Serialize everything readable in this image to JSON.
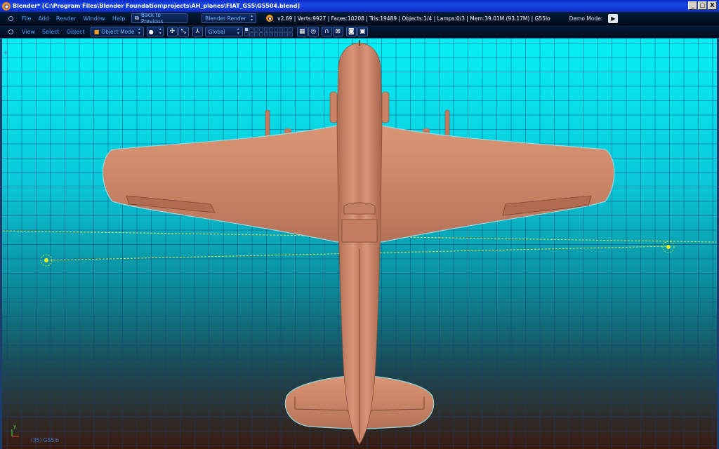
{
  "window": {
    "title": "Blender* [C:\\Program Files\\Blender Foundation\\projects\\AH_planes\\FIAT_G55\\G5504.blend]",
    "controls": [
      "_",
      "□",
      "X"
    ]
  },
  "info_header": {
    "menu": [
      "File",
      "Add",
      "Render",
      "Window",
      "Help"
    ],
    "back_button": "Back to Previous",
    "render_engine": "Blender Render",
    "stats": "v2.69 | Verts:9927 | Faces:10208 | Tris:19489 | Objects:1/4 | Lamps:0/3 | Mem:39.01M (93.17M) | G55lo",
    "demo_label": "Demo Mode:",
    "play_glyph": "▶"
  },
  "view3d_header": {
    "menu": [
      "View",
      "Select",
      "Object"
    ],
    "mode": "Object Mode",
    "orientation": "Global"
  },
  "viewport": {
    "corner_glyph": "+",
    "object_info": "(35) G55lo",
    "axis_label": "y",
    "colors": {
      "grid": "#143c78",
      "plane_body": "#c98566",
      "lamp": "#e8f020"
    }
  }
}
